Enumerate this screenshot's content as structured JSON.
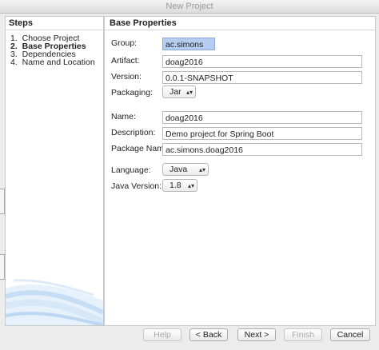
{
  "window": {
    "title": "New Project"
  },
  "steps": {
    "header": "Steps",
    "items": [
      {
        "num": "1.",
        "label": "Choose Project"
      },
      {
        "num": "2.",
        "label": "Base Properties"
      },
      {
        "num": "3.",
        "label": "Dependencies"
      },
      {
        "num": "4.",
        "label": "Name and Location"
      }
    ]
  },
  "form": {
    "header": "Base Properties",
    "group": {
      "label": "Group:",
      "value": "ac.simons"
    },
    "artifact": {
      "label": "Artifact:",
      "value": "doag2016"
    },
    "version": {
      "label": "Version:",
      "value": "0.0.1-SNAPSHOT"
    },
    "packaging": {
      "label": "Packaging:",
      "value": "Jar"
    },
    "name": {
      "label": "Name:",
      "value": "doag2016"
    },
    "description": {
      "label": "Description:",
      "value": "Demo project for Spring Boot"
    },
    "package_name": {
      "label": "Package Name:",
      "value": "ac.simons.doag2016"
    },
    "language": {
      "label": "Language:",
      "value": "Java"
    },
    "java_version": {
      "label": "Java Version:",
      "value": "1.8"
    }
  },
  "buttons": {
    "help": "Help",
    "back": "< Back",
    "next": "Next >",
    "finish": "Finish",
    "cancel": "Cancel"
  }
}
